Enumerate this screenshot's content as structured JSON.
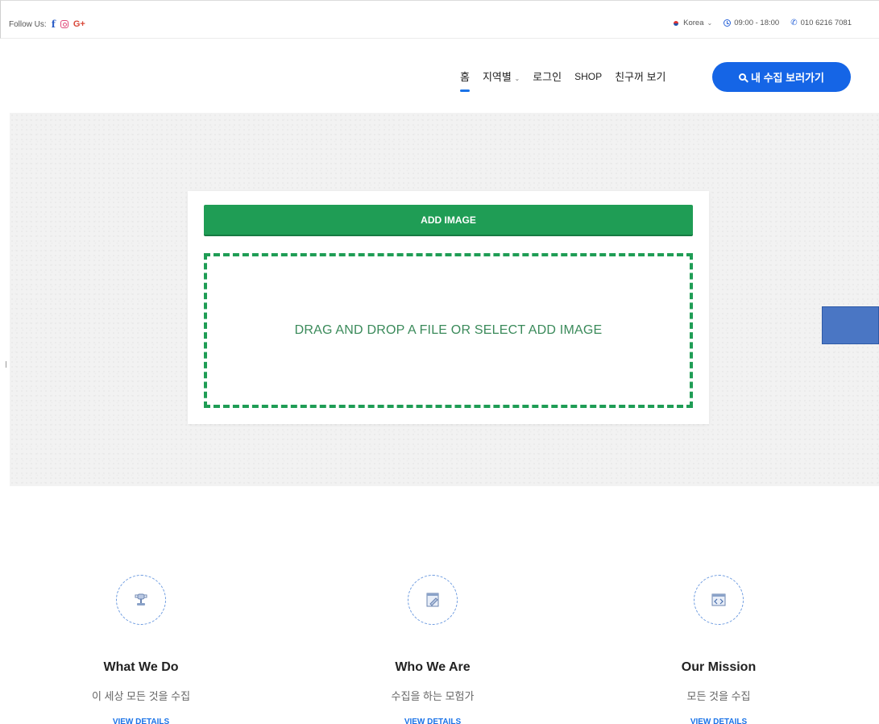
{
  "topbar": {
    "follow_label": "Follow Us:",
    "social": [
      "facebook-icon",
      "instagram-icon",
      "google-plus-icon"
    ],
    "social_glyphs": {
      "facebook": "f",
      "google": "G+"
    },
    "language": "Korea",
    "hours": "09:00 - 18:00",
    "phone": "010 6216 7081"
  },
  "nav": {
    "items": [
      "홈",
      "지역별",
      "로그인",
      "SHOP",
      "친구꺼 보기"
    ],
    "cta": "내 수집 보러가기"
  },
  "upload": {
    "add_button": "ADD IMAGE",
    "drop_text": "DRAG AND DROP A FILE OR SELECT ADD IMAGE"
  },
  "features": [
    {
      "icon": "trophy-icon",
      "title": "What We Do",
      "subtitle": "이 세상 모든 것을 수집",
      "link": "VIEW DETAILS"
    },
    {
      "icon": "edit-document-icon",
      "title": "Who We Are",
      "subtitle": "수집을 하는 모험가",
      "link": "VIEW DETAILS"
    },
    {
      "icon": "code-window-icon",
      "title": "Our Mission",
      "subtitle": "모든 것을 수집",
      "link": "VIEW DETAILS"
    }
  ],
  "colors": {
    "primary_blue": "#1565e6",
    "green": "#1f9d55",
    "side_box": "#4a76c4"
  }
}
